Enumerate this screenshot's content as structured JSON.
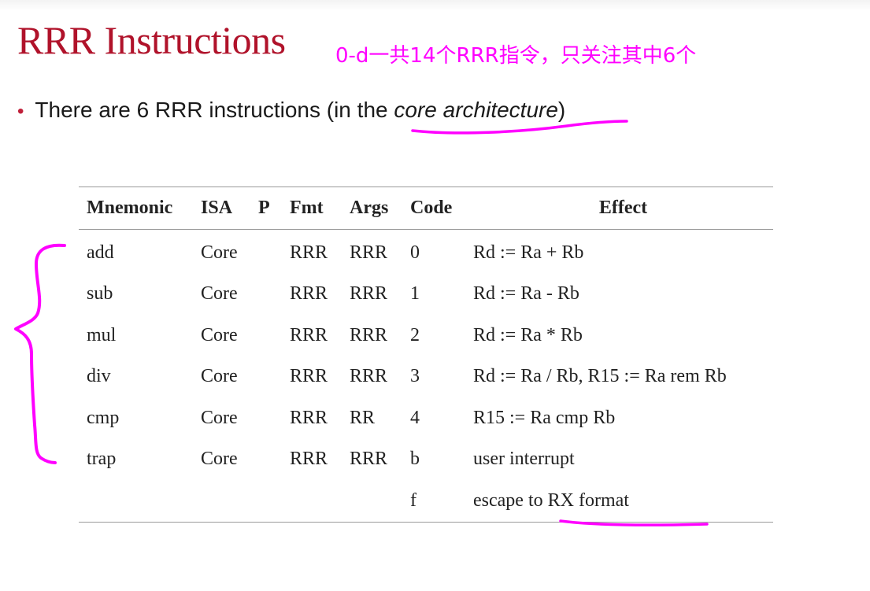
{
  "slide": {
    "title": "RRR Instructions",
    "handwritten_note": "0-d一共14个RRR指令，只关注其中6个",
    "bullet": {
      "prefix": "There are 6 RRR instructions (in the ",
      "emphasis": "core architecture",
      "suffix": ")"
    }
  },
  "table": {
    "headers": [
      "Mnemonic",
      "ISA",
      "P",
      "Fmt",
      "Args",
      "Code",
      "Effect"
    ],
    "rows": [
      [
        "add",
        "Core",
        "",
        "RRR",
        "RRR",
        "0",
        "Rd := Ra + Rb"
      ],
      [
        "sub",
        "Core",
        "",
        "RRR",
        "RRR",
        "1",
        "Rd := Ra - Rb"
      ],
      [
        "mul",
        "Core",
        "",
        "RRR",
        "RRR",
        "2",
        "Rd := Ra * Rb"
      ],
      [
        "div",
        "Core",
        "",
        "RRR",
        "RRR",
        "3",
        "Rd := Ra / Rb, R15 := Ra rem Rb"
      ],
      [
        "cmp",
        "Core",
        "",
        "RRR",
        "RR",
        "4",
        "R15 := Ra cmp Rb"
      ],
      [
        "trap",
        "Core",
        "",
        "RRR",
        "RRR",
        "b",
        "user interrupt"
      ],
      [
        "",
        "",
        "",
        "",
        "",
        "f",
        "escape to RX format"
      ]
    ]
  },
  "colors": {
    "title": "#b0122a",
    "annotation_ink": "#ff00ff",
    "bullet_dot": "#c0203a",
    "rule": "#9a9a9a"
  }
}
